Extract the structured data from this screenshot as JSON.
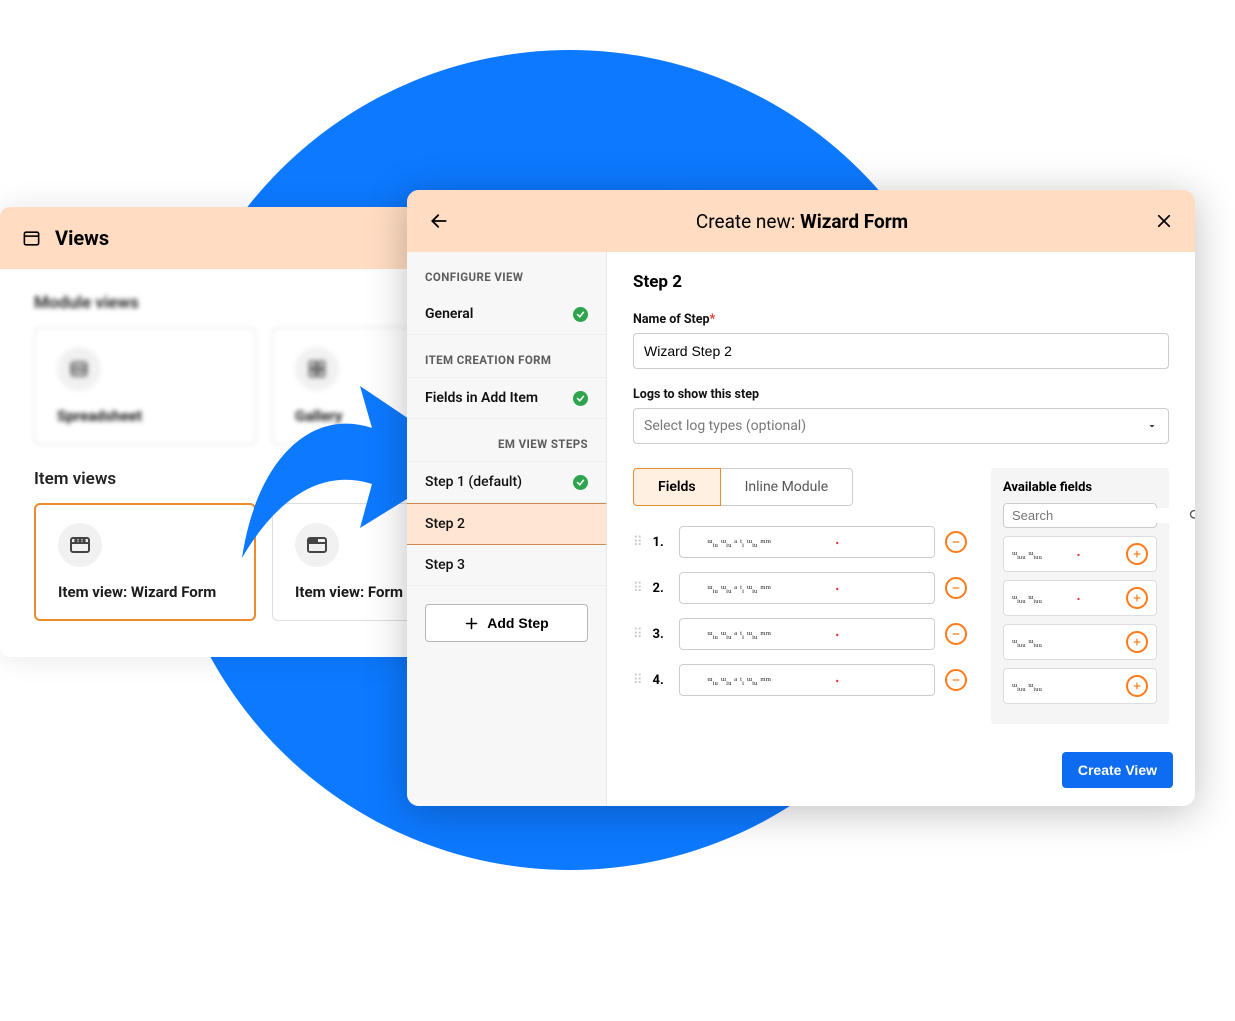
{
  "views_panel": {
    "title": "Views",
    "module_views_label": "Module views",
    "module_cards": [
      {
        "label": "Spreadsheet",
        "icon": "spreadsheet"
      },
      {
        "label": "Gallery",
        "icon": "gallery"
      }
    ],
    "item_views_label": "Item views",
    "item_cards": [
      {
        "label": "Item view: Wizard Form",
        "icon": "wizard",
        "selected": true
      },
      {
        "label": "Item view:  Form",
        "icon": "form",
        "selected": false
      }
    ]
  },
  "wizard": {
    "header_prefix": "Create new: ",
    "header_title": "Wizard Form",
    "sidebar": {
      "section1": "CONFIGURE VIEW",
      "general": "General",
      "section2": "ITEM CREATION FORM",
      "fields_in_add": "Fields in Add Item",
      "section3": "EM VIEW STEPS",
      "steps": [
        {
          "label": "Step 1 (default)",
          "check": true,
          "active": false
        },
        {
          "label": "Step 2",
          "check": false,
          "active": true
        },
        {
          "label": "Step 3",
          "check": false,
          "active": false
        }
      ],
      "add_step": "Add Step"
    },
    "content": {
      "heading": "Step 2",
      "name_label": "Name of Step",
      "name_value": "Wizard Step 2",
      "logs_label": "Logs to show this step",
      "logs_placeholder": "Select log types (optional)",
      "tabs": {
        "fields": "Fields",
        "inline": "Inline Module"
      },
      "rows": [
        "1.",
        "2.",
        "3.",
        "4."
      ],
      "available": {
        "title": "Available fields",
        "search_placeholder": "Search",
        "count": 4
      },
      "create_btn": "Create View"
    }
  }
}
